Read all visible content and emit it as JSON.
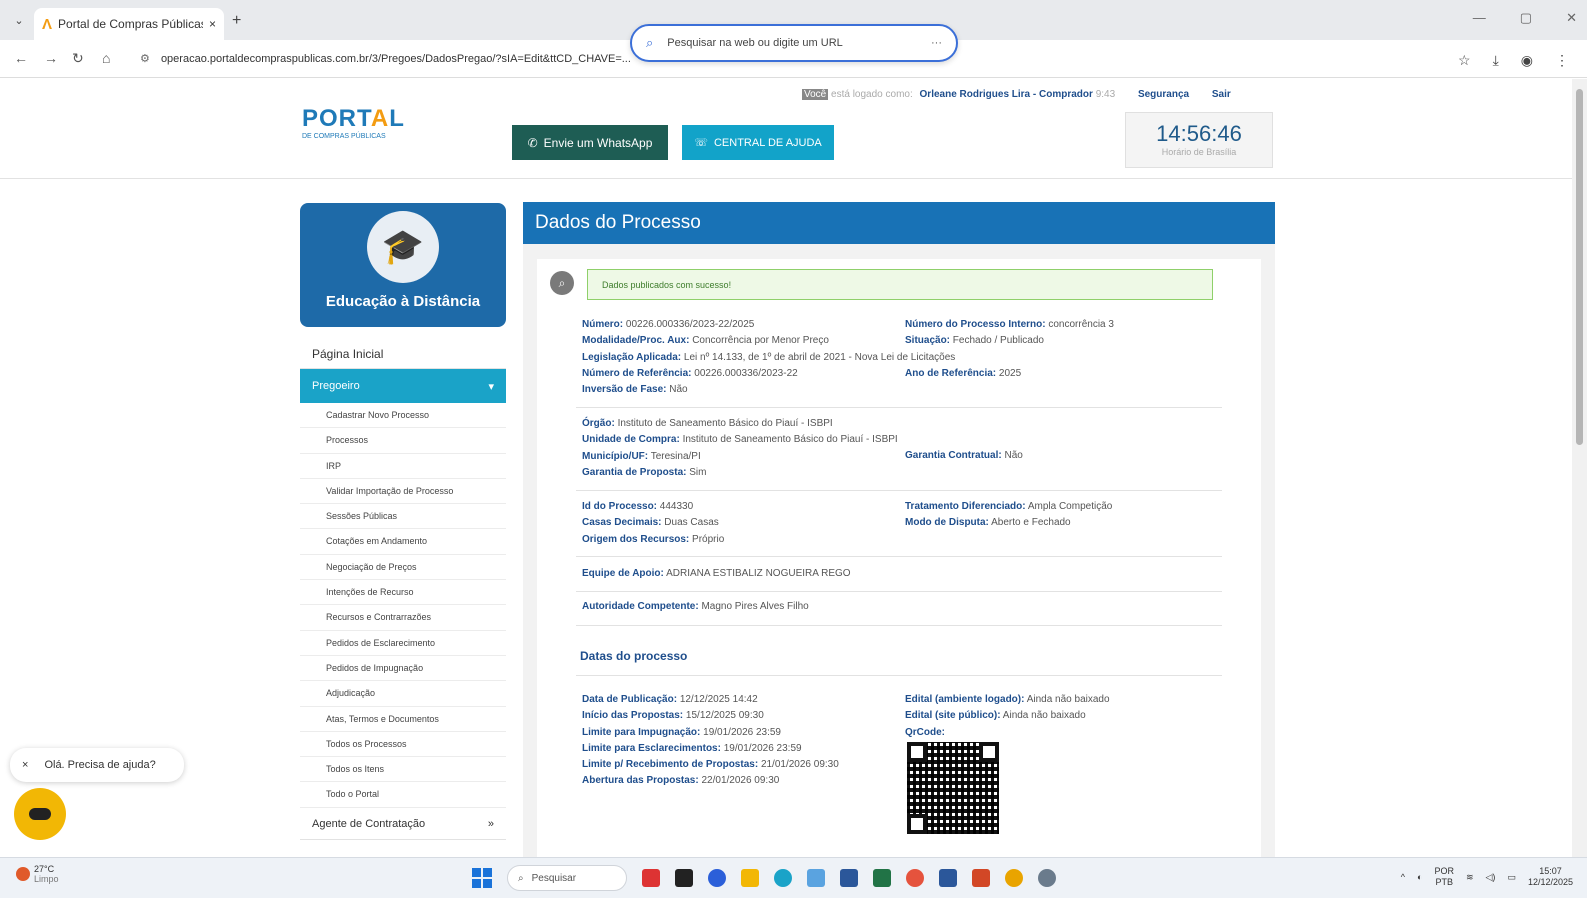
{
  "browser": {
    "tab_title": "Portal de Compras Públicas",
    "tab_close": "×",
    "new_tab": "+",
    "url": "operacao.portaldecompraspublicas.com.br/3/Pregoes/DadosPregao/?sIA=Edit&ttCD_CHAVE=...",
    "omnibox_placeholder": "Pesquisar na web ou digite um URL",
    "omnibox_more": "···"
  },
  "header": {
    "logo_text_1": "PORT",
    "logo_text_a": "A",
    "logo_text_2": "L",
    "logo_sub": "DE COMPRAS PÚBLICAS",
    "whatsapp_label": "Envie um WhatsApp",
    "help_label": "CENTRAL DE AJUDA",
    "user_prefix_voce": "Você",
    "user_prefix": "está logado como:",
    "user_name": "Orleane Rodrigues Lira - Comprador",
    "user_time": "9:43",
    "security_link": "Segurança",
    "logout_link": "Sair",
    "clock_time": "14:56:46",
    "clock_label": "Horário de Brasília"
  },
  "sidebar": {
    "edu_label": "Educação à Distância",
    "home": "Página Inicial",
    "active_section": "Pregoeiro",
    "active_arrow": "▾",
    "items": [
      "Cadastrar Novo Processo",
      "Processos",
      "IRP",
      "Validar Importação de Processo",
      "Sessões Públicas",
      "Cotações em Andamento",
      "Negociação de Preços",
      "Intenções de Recurso",
      "Recursos e Contrarrazões",
      "Pedidos de Esclarecimento",
      "Pedidos de Impugnação",
      "Adjudicação",
      "Atas, Termos e Documentos",
      "Todos os Processos",
      "Todos os Itens",
      "Todo o Portal"
    ],
    "bottom_section": "Agente de Contratação",
    "bottom_arrow": "»"
  },
  "main": {
    "title": "Dados do Processo",
    "alert": "Dados publicados com sucesso!",
    "group1": {
      "numero_label": "Número:",
      "numero": "00226.000336/2023-22/2025",
      "modalidade_label": "Modalidade/Proc. Aux:",
      "modalidade": "Concorrência por Menor Preço",
      "legislacao_label": "Legislação Aplicada:",
      "legislacao": "Lei nº 14.133, de 1º de abril de 2021 - Nova Lei de Licitações",
      "referencia_label": "Número de Referência:",
      "referencia": "00226.000336/2023-22",
      "inversao_label": "Inversão de Fase:",
      "inversao": "Não",
      "interno_label": "Número do Processo Interno:",
      "interno": "concorrência 3",
      "situacao_label": "Situação:",
      "situacao": "Fechado / Publicado",
      "ano_label": "Ano de Referência:",
      "ano": "2025"
    },
    "group2": {
      "orgao_label": "Órgão:",
      "orgao": "Instituto de Saneamento Básico do Piauí - ISBPI",
      "unidade_label": "Unidade de Compra:",
      "unidade": "Instituto de Saneamento Básico do Piauí - ISBPI",
      "municipio_label": "Município/UF:",
      "municipio": "Teresina/PI",
      "garantia_prop_label": "Garantia de Proposta:",
      "garantia_prop": "Sim",
      "garantia_contr_label": "Garantia Contratual:",
      "garantia_contr": "Não"
    },
    "group3": {
      "id_label": "Id do Processo:",
      "id": "444330",
      "casas_label": "Casas Decimais:",
      "casas": "Duas Casas",
      "origem_label": "Origem dos Recursos:",
      "origem": "Próprio",
      "tratamento_label": "Tratamento Diferenciado:",
      "tratamento": "Ampla Competição",
      "modo_label": "Modo de Disputa:",
      "modo": "Aberto e Fechado"
    },
    "equipe_label": "Equipe de Apoio:",
    "equipe": "ADRIANA ESTIBALIZ NOGUEIRA REGO",
    "autoridade_label": "Autoridade Competente:",
    "autoridade": "Magno Pires Alves Filho",
    "datas_title": "Datas do processo",
    "datas": {
      "pub_label": "Data de Publicação:",
      "pub": "12/12/2025 14:42",
      "inicio_label": "Início das Propostas:",
      "inicio": "15/12/2025 09:30",
      "impug_label": "Limite para Impugnação:",
      "impug": "19/01/2026 23:59",
      "escl_label": "Limite para Esclarecimentos:",
      "escl": "19/01/2026 23:59",
      "receb_label": "Limite p/ Recebimento de Propostas:",
      "receb": "21/01/2026 09:30",
      "abert_label": "Abertura das Propostas:",
      "abert": "22/01/2026 09:30",
      "edital_logado_label": "Edital (ambiente logado):",
      "edital_logado": "Ainda não baixado",
      "edital_pub_label": "Edital (site público):",
      "edital_pub": "Ainda não baixado",
      "qrcode_label": "QrCode:"
    }
  },
  "chat": {
    "close": "×",
    "text": "Olá. Precisa de ajuda?"
  },
  "taskbar": {
    "temp": "27°C",
    "weather": "Limpo",
    "search_placeholder": "Pesquisar",
    "lang_1": "POR",
    "lang_2": "PTB",
    "time": "15:07",
    "date": "12/12/2025"
  }
}
